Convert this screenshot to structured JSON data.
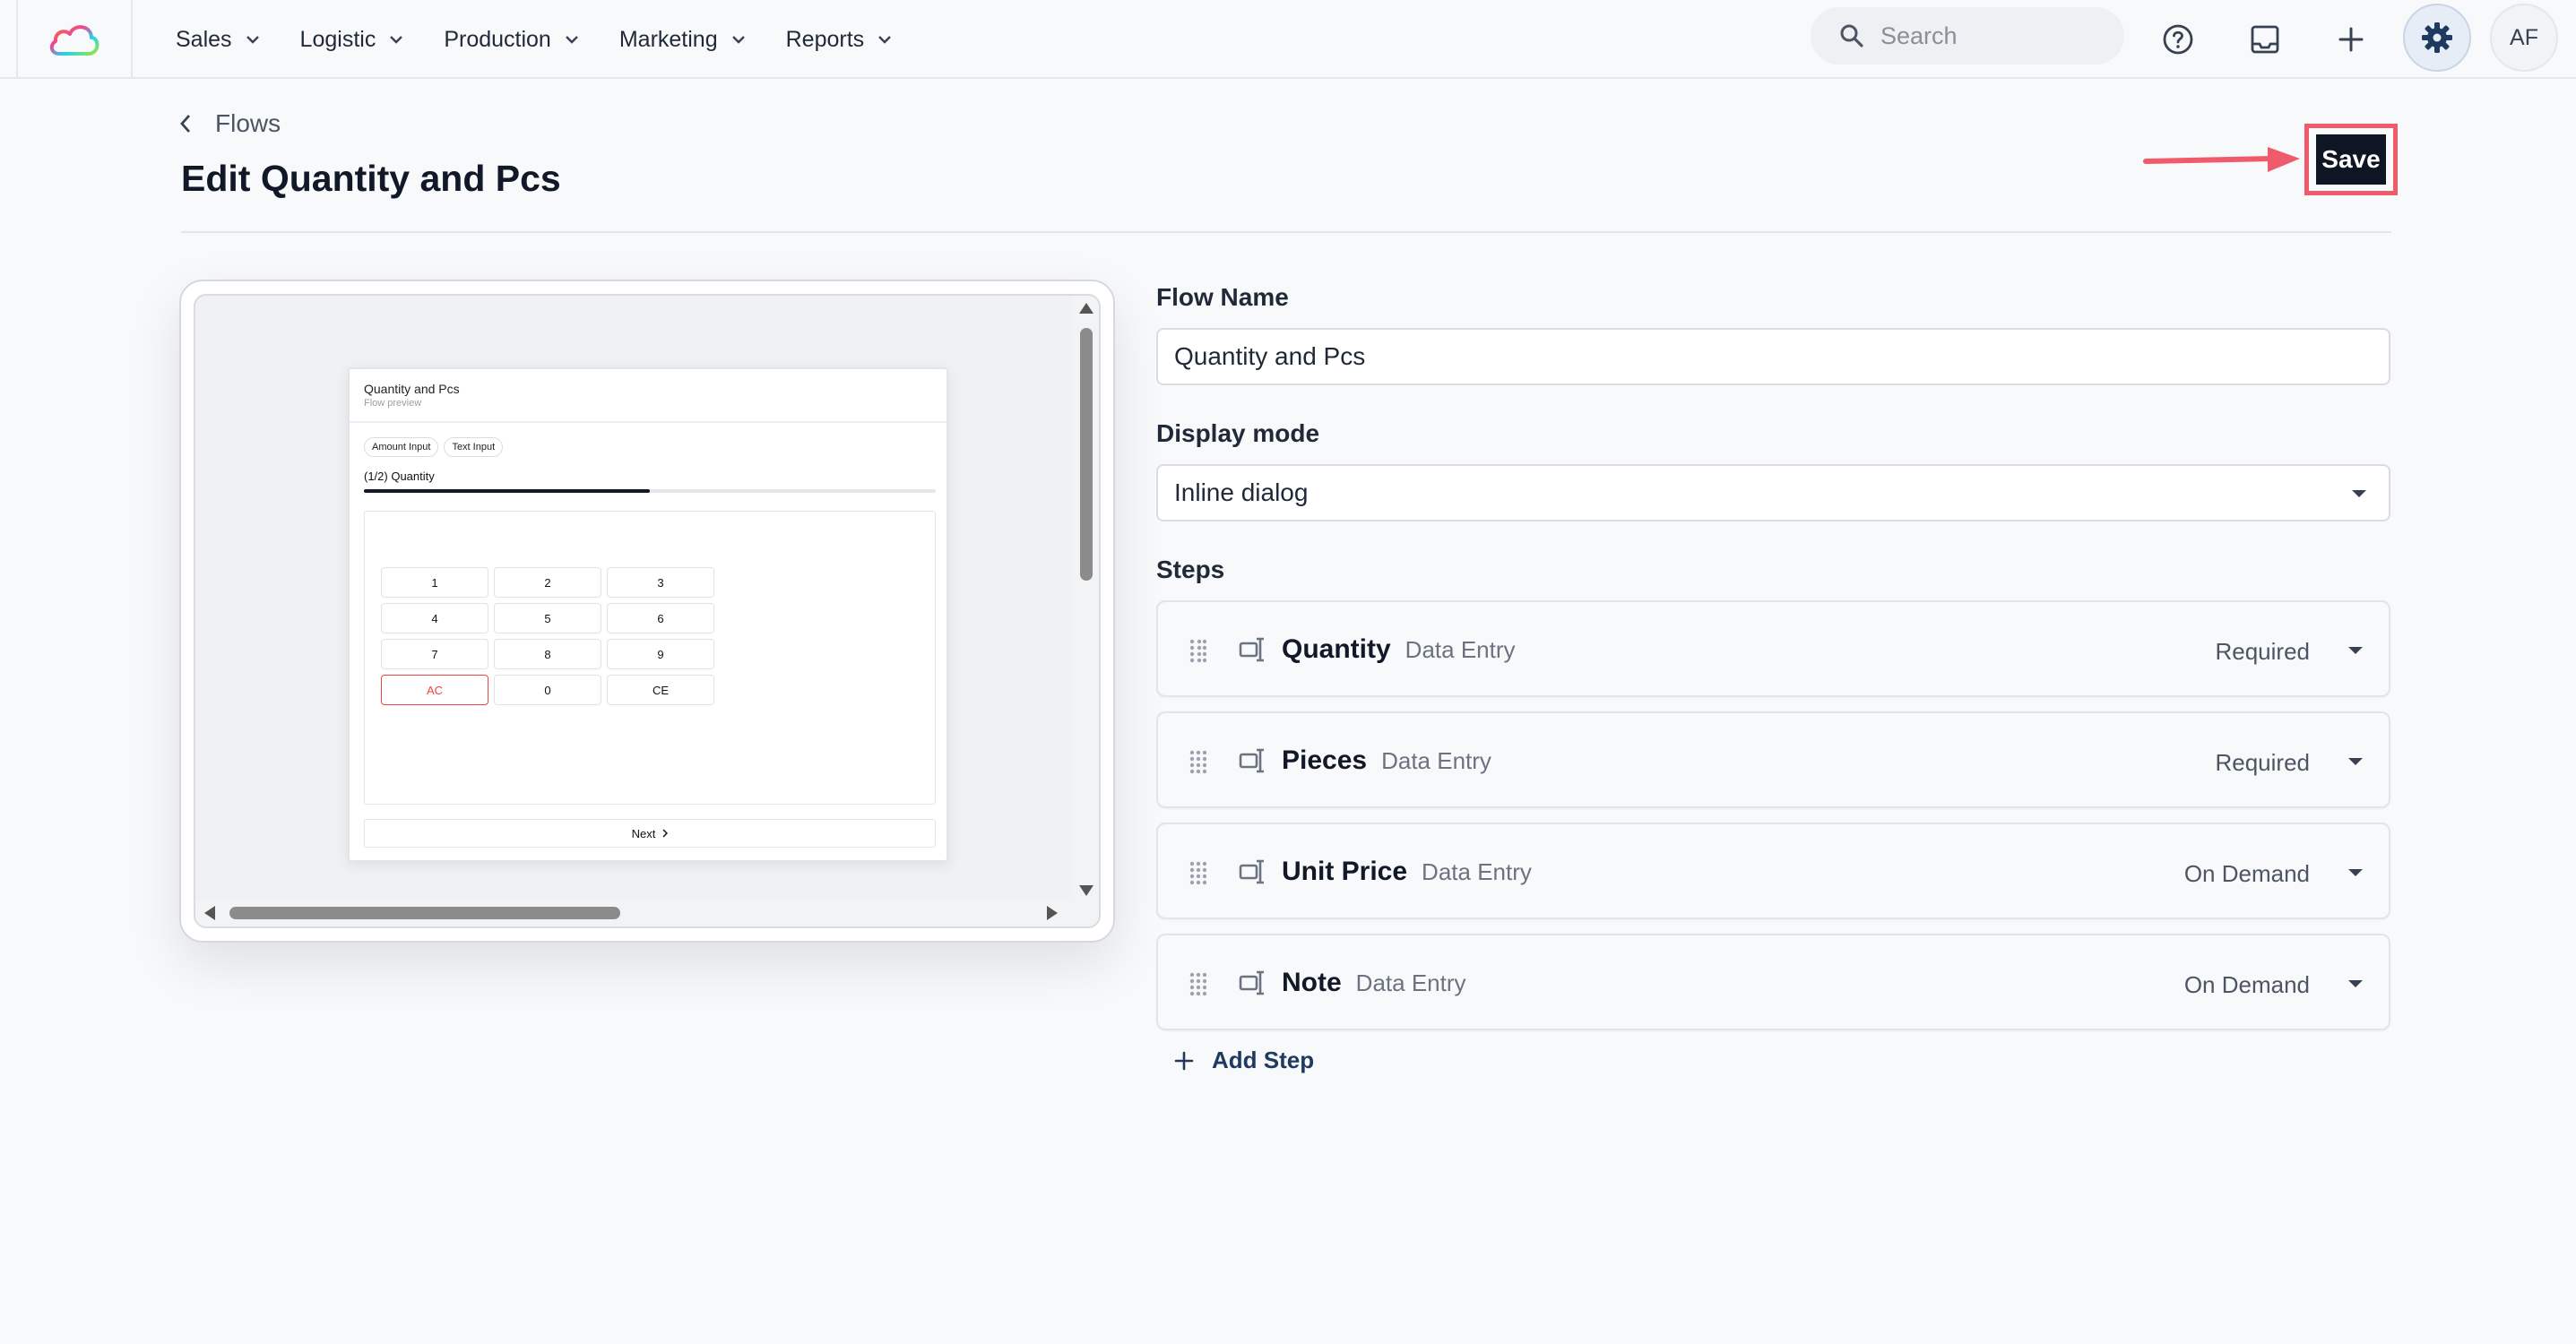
{
  "nav": {
    "items": [
      {
        "label": "Sales"
      },
      {
        "label": "Logistic"
      },
      {
        "label": "Production"
      },
      {
        "label": "Marketing"
      },
      {
        "label": "Reports"
      }
    ]
  },
  "search": {
    "placeholder": "Search"
  },
  "user": {
    "initials": "AF"
  },
  "breadcrumb": {
    "label": "Flows"
  },
  "page": {
    "title": "Edit Quantity and Pcs"
  },
  "actions": {
    "save_label": "Save"
  },
  "preview": {
    "title": "Quantity and Pcs",
    "subtitle": "Flow preview",
    "tabs": [
      "Amount Input",
      "Text Input"
    ],
    "step_label": "(1/2) Quantity",
    "progress": 0.5,
    "keys": [
      "1",
      "2",
      "3",
      "4",
      "5",
      "6",
      "7",
      "8",
      "9",
      "AC",
      "0",
      "CE"
    ],
    "next_label": "Next"
  },
  "form": {
    "flow_name_label": "Flow Name",
    "flow_name_value": "Quantity and Pcs",
    "display_mode_label": "Display mode",
    "display_mode_value": "Inline dialog",
    "steps_label": "Steps",
    "steps": [
      {
        "title": "Quantity",
        "type": "Data Entry",
        "mode": "Required"
      },
      {
        "title": "Pieces",
        "type": "Data Entry",
        "mode": "Required"
      },
      {
        "title": "Unit Price",
        "type": "Data Entry",
        "mode": "On Demand"
      },
      {
        "title": "Note",
        "type": "Data Entry",
        "mode": "On Demand"
      }
    ],
    "add_step_label": "Add Step"
  },
  "colors": {
    "accent_dark": "#0f1623",
    "highlight_red": "#ef5b6b",
    "settings_blue": "#1e3a5f"
  }
}
